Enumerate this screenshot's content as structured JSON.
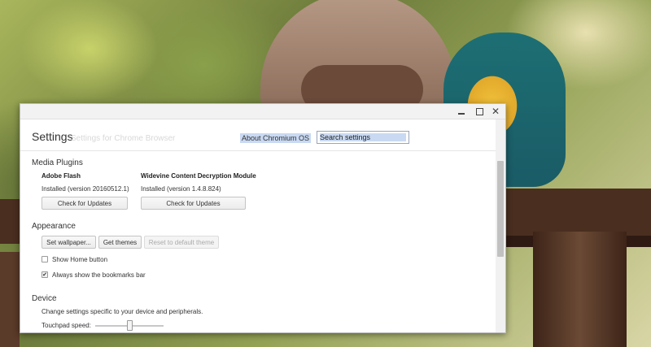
{
  "window": {
    "controls": {
      "minimize": "minimize",
      "maximize": "maximize",
      "close": "✕"
    }
  },
  "header": {
    "title": "Settings",
    "ghost_text": "Settings for Chrome Browser",
    "about_label": "About Chromium OS",
    "search_placeholder": "Search settings"
  },
  "media_plugins": {
    "heading": "Media Plugins",
    "plugins": [
      {
        "name": "Adobe Flash",
        "status": "Installed (version 20160512.1)",
        "button": "Check for Updates"
      },
      {
        "name": "Widevine Content Decryption Module",
        "status": "Installed (version 1.4.8.824)",
        "button": "Check for Updates"
      }
    ]
  },
  "appearance": {
    "heading": "Appearance",
    "buttons": {
      "wallpaper": "Set wallpaper...",
      "themes": "Get themes",
      "reset": "Reset to default theme"
    },
    "show_home": {
      "label": "Show Home button",
      "checked": false
    },
    "bookmarks_bar": {
      "label": "Always show the bookmarks bar",
      "checked": true,
      "mark": "✔"
    }
  },
  "device": {
    "heading": "Device",
    "description": "Change settings specific to your device and peripherals.",
    "touchpad_label": "Touchpad speed:",
    "touchpad_speed_fraction": 0.5
  },
  "icons": {
    "window_minimize": "minimize-icon",
    "window_maximize": "maximize-icon",
    "window_close": "close-icon",
    "checkbox_check": "check-icon"
  },
  "colors": {
    "selection_highlight": "#c9d9f2",
    "window_background": "#ffffff",
    "titlebar": "#f2f2f2"
  }
}
